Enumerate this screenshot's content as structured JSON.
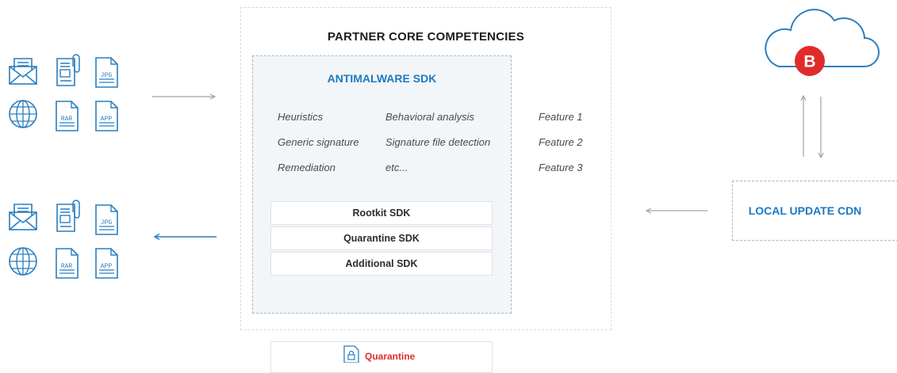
{
  "partner": {
    "title": "PARTNER CORE COMPETENCIES"
  },
  "sdk": {
    "title": "ANTIMALWARE SDK",
    "features_col1": [
      "Heuristics",
      "Generic signature",
      "Remediation"
    ],
    "features_col2": [
      "Behavioral analysis",
      "Signature file detection",
      "etc..."
    ],
    "features_col3": [
      "Feature 1",
      "Feature 2",
      "Feature 3"
    ],
    "modules": [
      "Rootkit SDK",
      "Quarantine SDK",
      "Additional SDK"
    ]
  },
  "quarantine": {
    "label": "Quarantine"
  },
  "cdn": {
    "label": "LOCAL UPDATE CDN"
  },
  "cloud": {
    "badge": "B"
  },
  "file_icons": {
    "jpg": "JPG",
    "rar": "RAR",
    "app": "APP"
  },
  "colors": {
    "accent_blue": "#1a7ac2",
    "brand_red": "#e02b2b",
    "icon_blue": "#2a7fc0"
  }
}
